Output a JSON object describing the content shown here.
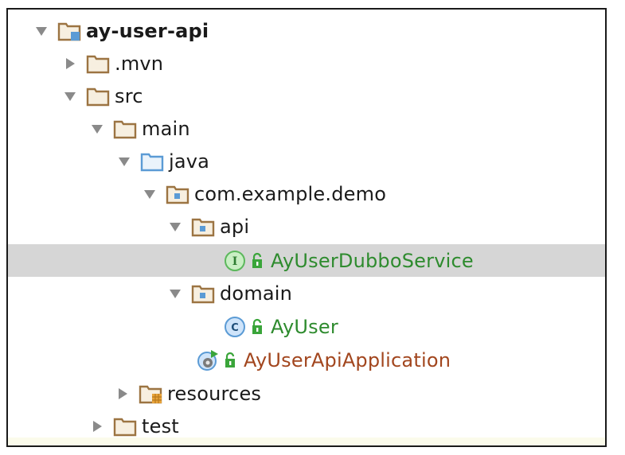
{
  "project_tree": {
    "root": {
      "label": "ay-user-api",
      "state": "expanded",
      "icon": "module-folder-icon"
    },
    "mvn": {
      "label": ".mvn",
      "state": "collapsed",
      "icon": "folder-icon"
    },
    "src": {
      "label": "src",
      "state": "expanded",
      "icon": "folder-icon"
    },
    "main": {
      "label": "main",
      "state": "expanded",
      "icon": "folder-icon"
    },
    "java": {
      "label": "java",
      "state": "expanded",
      "icon": "source-root-folder-icon"
    },
    "package_demo": {
      "label": "com.example.demo",
      "state": "expanded",
      "icon": "package-icon"
    },
    "package_api": {
      "label": "api",
      "state": "expanded",
      "icon": "package-icon"
    },
    "dubbo_service": {
      "label": "AyUserDubboService",
      "icon": "interface-icon",
      "selected": true
    },
    "package_domain": {
      "label": "domain",
      "state": "expanded",
      "icon": "package-icon"
    },
    "ay_user": {
      "label": "AyUser",
      "icon": "class-icon"
    },
    "application": {
      "label": "AyUserApiApplication",
      "icon": "spring-boot-app-icon"
    },
    "resources": {
      "label": "resources",
      "state": "collapsed",
      "icon": "resources-folder-icon"
    },
    "test": {
      "label": "test",
      "state": "collapsed",
      "icon": "folder-icon"
    }
  },
  "colors": {
    "folder": "#b08a55",
    "source_folder": "#5b9bd5",
    "vcs_added_green": "#2e8b2e",
    "vcs_modified_brown": "#a2461e",
    "selection": "#d6d6d6",
    "arrow": "#8a8a8a"
  }
}
